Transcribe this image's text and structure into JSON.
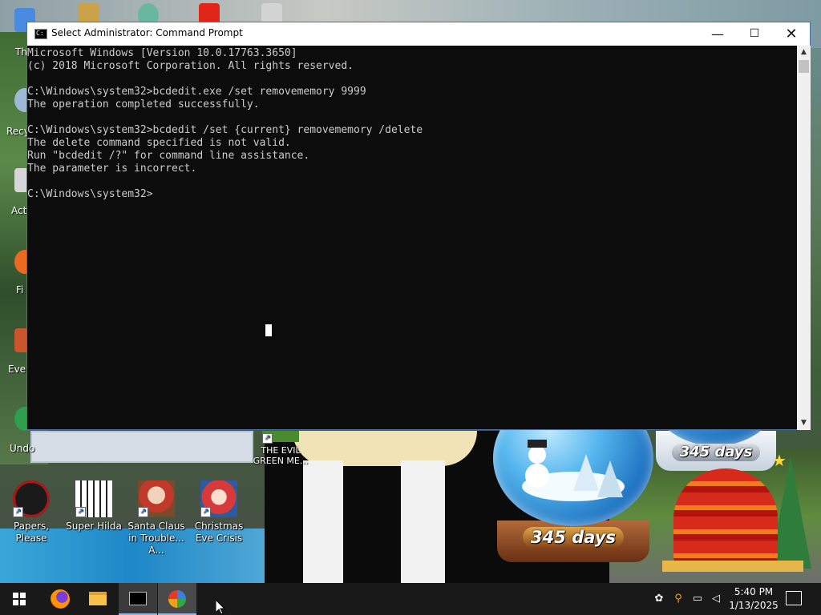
{
  "window": {
    "title": "Select Administrator: Command Prompt",
    "controls": {
      "minimize": "—",
      "maximize": "☐",
      "close": "✕"
    },
    "console_text": "Microsoft Windows [Version 10.0.17763.3650]\n(c) 2018 Microsoft Corporation. All rights reserved.\n\nC:\\Windows\\system32>bcdedit.exe /set removememory 9999\nThe operation completed successfully.\n\nC:\\Windows\\system32>bcdedit /set {current} removememory /delete\nThe delete command specified is not valid.\nRun \"bcdedit /?\" for command line assistance.\nThe parameter is incorrect.\n\nC:\\Windows\\system32>"
  },
  "desktop": {
    "icons": [
      {
        "label": "Papers, Please",
        "icon": "papers-please-icon",
        "color": "#b01818"
      },
      {
        "label": "Super Hilda",
        "icon": "super-hilda-icon",
        "color": "#f0f0f0"
      },
      {
        "label": "Santa Claus in Trouble... A...",
        "icon": "santa-trouble-icon",
        "color": "#c0392b"
      },
      {
        "label": "Christmas Eve Crisis",
        "icon": "christmas-eve-icon",
        "color": "#d63a3a"
      },
      {
        "label": "THE EVIL GREEN ME...",
        "icon": "evil-green-icon",
        "color": "#4b8b2f"
      }
    ],
    "edge_labels": {
      "th": "Th",
      "recy": "Recy",
      "act": "Act",
      "fi": "Fi",
      "ever": "Ever",
      "undo": "Undo"
    },
    "widgets": {
      "globe_countdown_top": "345 days",
      "globe_countdown_bottom": "345 days"
    }
  },
  "taskbar": {
    "apps": [
      {
        "name": "start",
        "icon": "windows-logo-icon"
      },
      {
        "name": "firefox",
        "icon": "firefox-icon"
      },
      {
        "name": "file-explorer",
        "icon": "folder-icon"
      },
      {
        "name": "command-prompt",
        "icon": "cmd-icon"
      },
      {
        "name": "app",
        "icon": "app-icon"
      }
    ],
    "time": "5:40 PM",
    "date": "1/13/2025"
  },
  "colors": {
    "console_bg": "#0c0c0c",
    "console_text": "#cccccc",
    "taskbar_bg": "#191919",
    "accent": "#8fb8e6"
  }
}
